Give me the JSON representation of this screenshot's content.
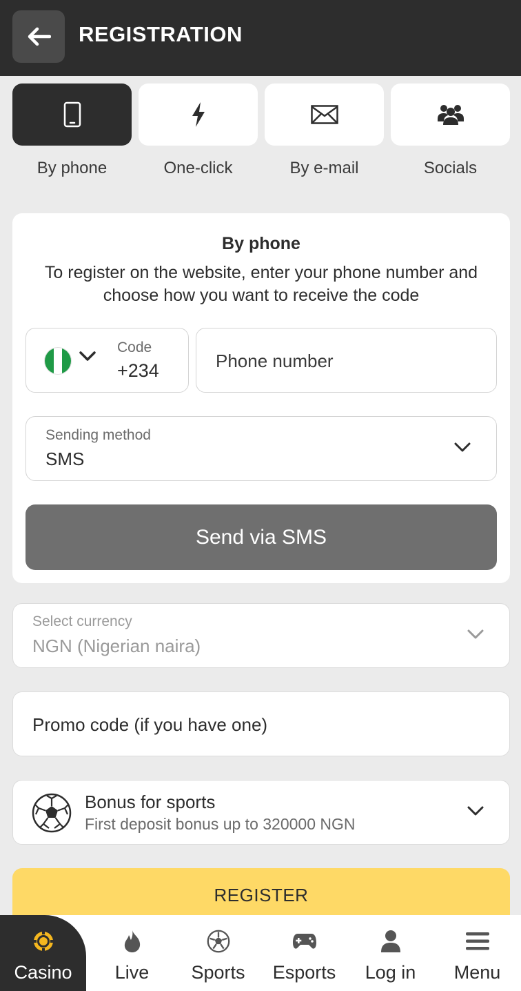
{
  "header": {
    "title": "REGISTRATION"
  },
  "tabs": [
    {
      "label": "By phone",
      "icon": "phone-icon"
    },
    {
      "label": "One-click",
      "icon": "lightning-icon"
    },
    {
      "label": "By e-mail",
      "icon": "envelope-icon"
    },
    {
      "label": "Socials",
      "icon": "people-icon"
    }
  ],
  "form": {
    "title": "By phone",
    "description": "To register on the website, enter your phone number and choose how you want to receive the code",
    "code_label": "Code",
    "code_value": "+234",
    "phone_placeholder": "Phone number",
    "method_label": "Sending method",
    "method_value": "SMS",
    "send_button": "Send via SMS"
  },
  "currency": {
    "label": "Select currency",
    "value": "NGN (Nigerian naira)"
  },
  "promo": {
    "placeholder": "Promo code (if you have one)"
  },
  "bonus": {
    "title": "Bonus for sports",
    "subtitle": "First deposit bonus up to 320000 NGN"
  },
  "register_button": "REGISTER",
  "bottom_nav": [
    {
      "label": "Casino",
      "icon": "casino-chip-icon"
    },
    {
      "label": "Live",
      "icon": "flame-icon"
    },
    {
      "label": "Sports",
      "icon": "soccer-ball-icon"
    },
    {
      "label": "Esports",
      "icon": "gamepad-icon"
    },
    {
      "label": "Log in",
      "icon": "user-icon"
    },
    {
      "label": "Menu",
      "icon": "menu-icon"
    }
  ],
  "colors": {
    "header_bg": "#2d2d2d",
    "accent_yellow": "#fed966",
    "button_gray": "#6f6f6f",
    "casino_icon": "#f5b71f"
  }
}
